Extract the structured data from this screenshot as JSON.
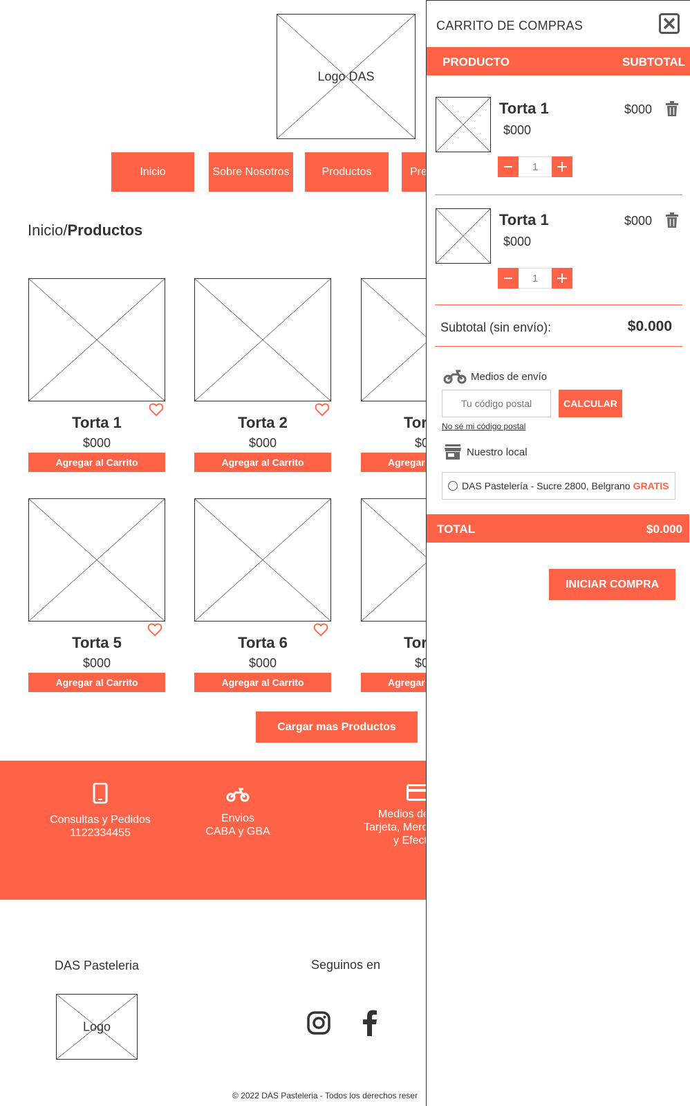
{
  "header": {
    "logo_label": "Logo DAS"
  },
  "nav": [
    {
      "label": "Inicio"
    },
    {
      "label": "Sobre Nosotros"
    },
    {
      "label": "Productos"
    },
    {
      "label": "Pre"
    }
  ],
  "breadcrumb": {
    "home": "Inicio/",
    "current": "Productos"
  },
  "products": [
    {
      "name": "Torta 1",
      "price": "$000",
      "button": "Agregar al Carrito"
    },
    {
      "name": "Torta 2",
      "price": "$000",
      "button": "Agregar al Carrito"
    },
    {
      "name": "Tor",
      "price": "$0",
      "button": "Agregar"
    },
    {
      "name": "Torta 5",
      "price": "$000",
      "button": "Agregar al Carrito"
    },
    {
      "name": "Torta 6",
      "price": "$000",
      "button": "Agregar al Carrito"
    },
    {
      "name": "Tor",
      "price": "$0",
      "button": "Agregar"
    }
  ],
  "load_more": "Cargar mas Productos",
  "features": {
    "contact": {
      "line1": "Consultas y Pedidos",
      "line2": "1122334455",
      "icon": "phone-icon"
    },
    "shipping": {
      "line1": "Envios",
      "line2": "CABA  y GBA",
      "icon": "motorcycle-icon"
    },
    "payment": {
      "line1": "Medios de",
      "line2": "Tarjeta, Merc",
      "line3": "y Efect",
      "icon": "credit-card-icon"
    }
  },
  "footer": {
    "brand_title": "DAS Pasteleria",
    "logo_label": "Logo",
    "social_title": "Seguinos en",
    "copyright_symbol": "©",
    "copyright": "2022 DAS Pasteleria - Todos los derechos reser"
  },
  "cart": {
    "title": "CARRITO DE COMPRAS",
    "col_product": "PRODUCTO",
    "col_subtotal": "SUBTOTAL",
    "items": [
      {
        "name": "Torta 1",
        "price": "$000",
        "subtotal": "$000",
        "qty": "1"
      },
      {
        "name": "Torta 1",
        "price": "$000",
        "subtotal": "$000",
        "qty": "1"
      }
    ],
    "subtotal_label": "Subtotal (sin envío):",
    "subtotal_value": "$0.000",
    "shipping_label": "Medios de envío",
    "zip_placeholder": "Tu código postal",
    "calc_button": "CALCULAR",
    "zip_link": "No sé mi código postal",
    "local_label": "Nuestro local",
    "local_option": "DAS Pastelería - Sucre 2800, Belgrano",
    "local_free": "GRATIS",
    "total_label": "TOTAL",
    "total_value": "$0.000",
    "buy_button": "INICIAR COMPRA"
  },
  "colors": {
    "accent": "#ff6347",
    "text": "#333333"
  }
}
